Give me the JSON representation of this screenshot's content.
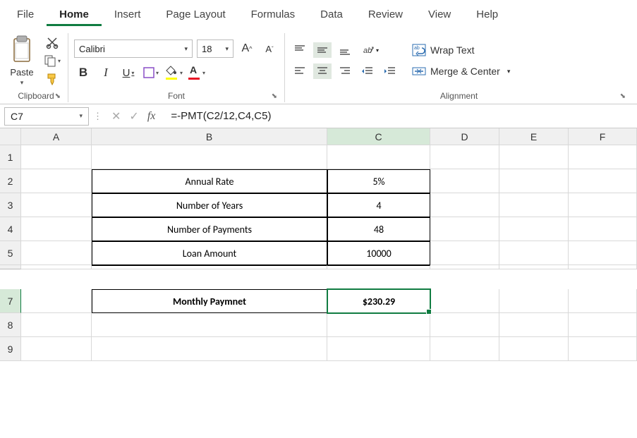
{
  "menu": {
    "file": "File",
    "home": "Home",
    "insert": "Insert",
    "pagelayout": "Page Layout",
    "formulas": "Formulas",
    "data": "Data",
    "review": "Review",
    "view": "View",
    "help": "Help"
  },
  "ribbon": {
    "clipboard": {
      "label": "Clipboard",
      "paste": "Paste"
    },
    "font": {
      "label": "Font",
      "name": "Calibri",
      "size": "18",
      "bold": "B",
      "italic": "I",
      "underline": "U",
      "bigA": "A",
      "smallA": "A"
    },
    "alignment": {
      "label": "Alignment",
      "wrap": "Wrap Text",
      "merge": "Merge & Center"
    }
  },
  "formula_bar": {
    "name_box": "C7",
    "cancel": "✕",
    "enter": "✓",
    "fx": "fx",
    "formula": "=-PMT(C2/12,C4,C5)"
  },
  "columns": [
    "A",
    "B",
    "C",
    "D",
    "E",
    "F"
  ],
  "rows": [
    "1",
    "2",
    "3",
    "4",
    "5",
    "7",
    "8",
    "9"
  ],
  "cells": {
    "B2": "Annual Rate",
    "C2": "5%",
    "B3": "Number of Years",
    "C3": "4",
    "B4": "Number of Payments",
    "C4": "48",
    "B5": "Loan Amount",
    "C5": "10000",
    "B7": "Monthly Paymnet",
    "C7": "$230.29"
  },
  "chart_data": {
    "type": "table",
    "title": "Loan Calculation (PMT)",
    "rows": [
      {
        "label": "Annual Rate",
        "value": "5%"
      },
      {
        "label": "Number of Years",
        "value": 4
      },
      {
        "label": "Number of Payments",
        "value": 48
      },
      {
        "label": "Loan Amount",
        "value": 10000
      },
      {
        "label": "Monthly Paymnet",
        "value": 230.29
      }
    ],
    "formula": "=-PMT(C2/12,C4,C5)"
  }
}
